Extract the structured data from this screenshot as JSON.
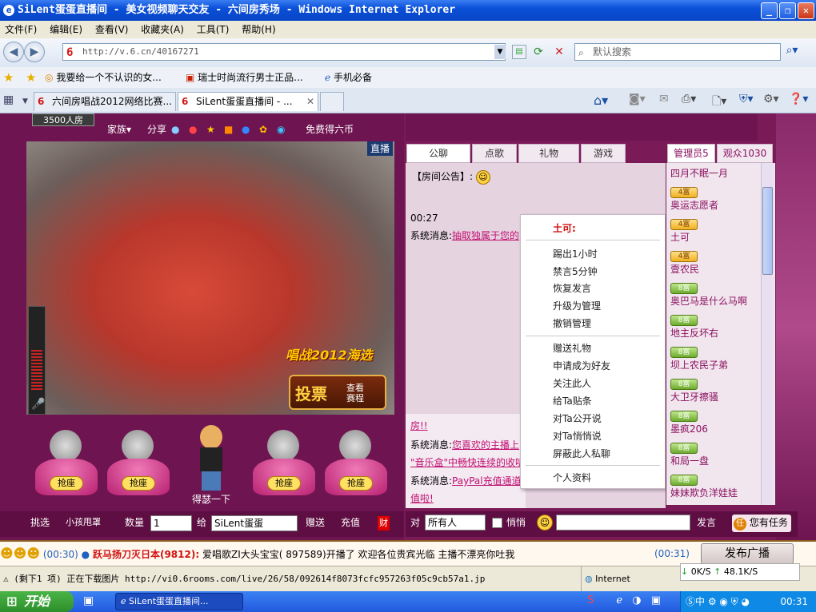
{
  "window": {
    "title": "SiLent蛋蛋直播间 - 美女视频聊天交友 - 六间房秀场 - Windows Internet Explorer"
  },
  "menu": [
    "文件(F)",
    "编辑(E)",
    "查看(V)",
    "收藏夹(A)",
    "工具(T)",
    "帮助(H)"
  ],
  "address": {
    "url": "http://v.6.cn/40167271",
    "search_placeholder": "默认搜索"
  },
  "favorites": [
    "我要给一个不认识的女...",
    "瑞士时尚流行男士正品...",
    "手机必备"
  ],
  "tabs": [
    "六间房唱战2012网络比赛...",
    "SiLent蛋蛋直播间 - ..."
  ],
  "room": {
    "count": "3500人房",
    "family": "家族",
    "share": "分享",
    "free": "免费得六币",
    "live_badge": "直播",
    "vote": "投票",
    "watch": "查看赛程",
    "contest": "唱战2012海选"
  },
  "seats": [
    "抢座",
    "抢座",
    "抢座",
    "抢座"
  ],
  "host_name": "得瑟一下",
  "gift_bar": {
    "pick": "挑选",
    "gift": "小孩甩罩",
    "qty_label": "数量",
    "qty": "1",
    "to": "给",
    "to_name": "SiLent蛋蛋",
    "send": "赠送",
    "recharge": "充值",
    "rich": "财"
  },
  "chat_tabs": [
    "公聊",
    "点歌",
    "礼物",
    "游戏"
  ],
  "chat": {
    "notice": "【房间公告】:",
    "time": "00:27",
    "sys_label": "系统消息:",
    "msg1": "抽取独属于您的",
    "msg2_a": "房!!",
    "msg3_label": "系统消息:",
    "msg3": "您喜欢的主播上",
    "msg4": "\"音乐盒\"中畅快连续的收听",
    "msg5_label": "系统消息:",
    "msg5": "PayPal充值通道",
    "msg6": "值啦!"
  },
  "context_menu": {
    "title": "土可:",
    "items1": [
      "踢出1小时",
      "禁言5分钟",
      "恢复发言",
      "升级为管理",
      "撤销管理"
    ],
    "items2": [
      "赠送礼物",
      "申请成为好友",
      "关注此人",
      "给Ta贴条",
      "对Ta公开说",
      "对Ta悄悄说",
      "屏蔽此人私聊"
    ],
    "items3": [
      "个人资料"
    ]
  },
  "user_tabs": [
    "管理员5",
    "观众1030"
  ],
  "users": [
    {
      "name": "四月不眠一月",
      "badge": ""
    },
    {
      "name": "奥运志愿者",
      "badge": "4富"
    },
    {
      "name": "土可",
      "badge": "4富"
    },
    {
      "name": "壹农民",
      "badge": "4富"
    },
    {
      "name": "奥巴马是什么马啊",
      "badge": "8富"
    },
    {
      "name": "地主反坏右",
      "badge": "8富"
    },
    {
      "name": "坝上农民子弟",
      "badge": "8富"
    },
    {
      "name": "大卫牙擦骚",
      "badge": "8富"
    },
    {
      "name": "墨疯206",
      "badge": "8富"
    },
    {
      "name": "和局一盘",
      "badge": "8富"
    },
    {
      "name": "妹妹欺负洋娃娃",
      "badge": "8富"
    }
  ],
  "input_row": {
    "to_label": "对",
    "to": "所有人",
    "whisper": "悄悄",
    "send": "发言",
    "task": "您有任务"
  },
  "ticker": {
    "prefix": "(00:30)",
    "headline": "跃马扬刀灭日本(9812):",
    "text": "爱唱歌ZI大头宝宝( 897589)开播了 欢迎各位贵宾光临",
    "tail": "主播不漂亮你吐我",
    "time2": "(00:31)",
    "broadcast": "发布广播"
  },
  "status": {
    "text": "(剩下1 项) 正在下载图片 http://vi0.6rooms.com/live/26/58/092614f8073fcfc957263f05c9cb57a1.jp",
    "zone": "Internet",
    "down": "0K/S",
    "up": "48.1K/S"
  },
  "taskbar": {
    "start": "开始",
    "task": "SiLent蛋蛋直播间...",
    "clock": "00:31"
  }
}
